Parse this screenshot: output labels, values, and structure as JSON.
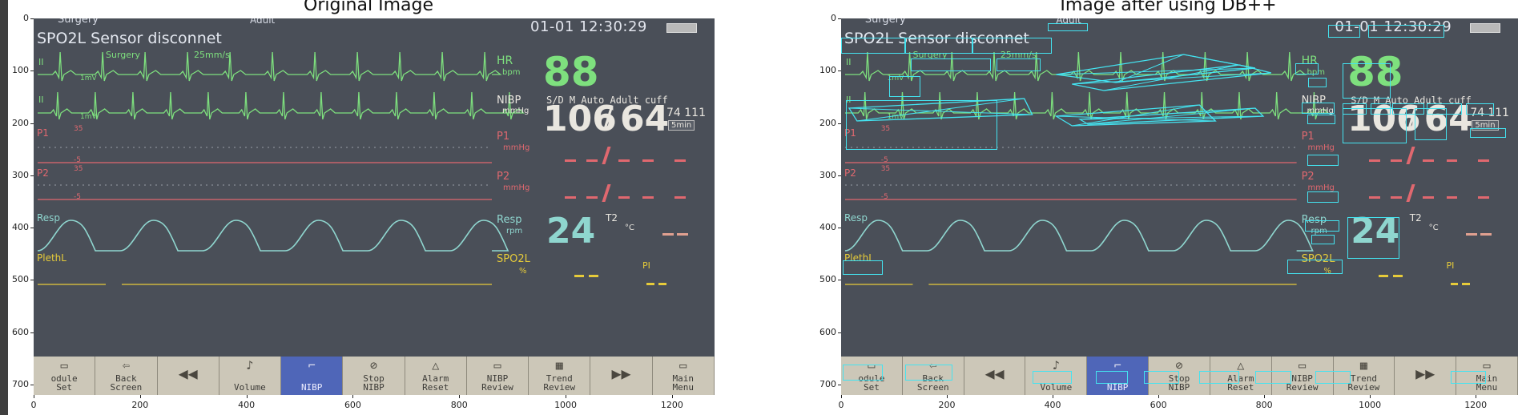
{
  "left_title": "Original Image",
  "right_title": "Image after using DB++",
  "y_ticks": [
    "0",
    "100",
    "200",
    "300",
    "400",
    "500",
    "600",
    "700"
  ],
  "x_ticks": [
    "0",
    "200",
    "400",
    "600",
    "800",
    "1000",
    "1200"
  ],
  "monitor": {
    "top_left": "Surgery",
    "mode": "Adult",
    "clock": "01-01 12:30:29",
    "clock_date": "01-01",
    "clock_time": "12:30:29",
    "alarm": "SPO2L Sensor disconnet",
    "alarm_words": [
      "SPO2L",
      "Sensor",
      "disconnet"
    ],
    "ecg_lead": "II",
    "ecg_mode": "Surgery",
    "ecg_speed": "25mm/s",
    "ecg_gain": "1mV",
    "hr_label": "HR",
    "hr_unit": "bpm",
    "hr_value": "88",
    "nibp_label": "NIBP",
    "nibp_unit": "mmHg",
    "nibp_mode": "S/D M Auto Adult cuff",
    "nibp_mode_words": [
      "S/D",
      "M",
      "Auto",
      "Adult",
      "cuff"
    ],
    "nibp_sys": "106",
    "nibp_slash": "/",
    "nibp_dia": "64",
    "nibp_mean": "74 111",
    "nibp_interval": "5min",
    "p1_label": "P1",
    "p1_scale": "35",
    "p1_unit": "mmHg",
    "p2_label": "P2",
    "p2_scale": "35",
    "p2_unit": "mmHg",
    "scale_low": "-5",
    "resp_label": "Resp",
    "resp_unit": "rpm",
    "resp_value": "24",
    "t2_label": "T2",
    "t2_unit": "°C",
    "pleth_label": "PlethL",
    "spo2_label": "SPO2L",
    "spo2_unit": "%",
    "pi_label": "PI"
  },
  "buttons": [
    {
      "label": "odule\nSet",
      "icon": "module-icon"
    },
    {
      "label": "Back\nScreen",
      "icon": "back-arrow-icon"
    },
    {
      "label": "",
      "icon": "rewind-icon"
    },
    {
      "label": "Volume",
      "icon": "volume-icon"
    },
    {
      "label": "NIBP",
      "icon": "nibp-icon",
      "active": true
    },
    {
      "label": "Stop\nNIBP",
      "icon": "stop-icon"
    },
    {
      "label": "Alarm\nReset",
      "icon": "alarm-icon"
    },
    {
      "label": "NIBP\nReview",
      "icon": "review-icon"
    },
    {
      "label": "Trend\nReview",
      "icon": "trend-icon"
    },
    {
      "label": "",
      "icon": "fast-forward-icon"
    },
    {
      "label": "Main\nMenu",
      "icon": "menu-icon"
    }
  ],
  "colors": {
    "detection_box": "#44e3f0",
    "screen_bg": "#4a4f58",
    "active_button": "#4f66b8",
    "ecg": "#7ee07e",
    "pressure": "#e0686f",
    "resp": "#8fd6cf",
    "spo2": "#e6cb3a"
  }
}
